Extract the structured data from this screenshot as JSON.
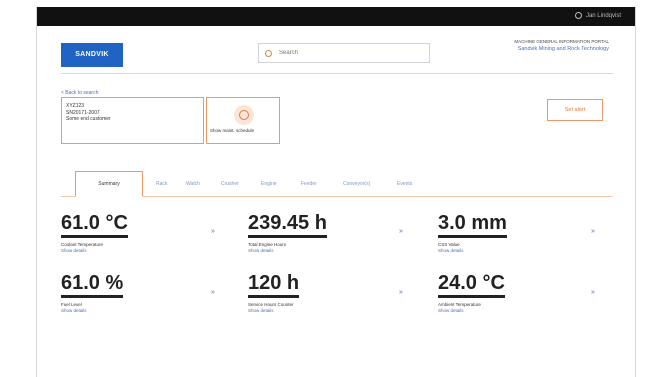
{
  "topbar": {
    "user_label": "Jan Lindqvist"
  },
  "header": {
    "logo_text": "SANDVIK",
    "search_placeholder": "Search",
    "right_line1": "MACHINE GENERAL INFORMATION PORTAL",
    "right_line2": "Sandvik Mining and Rock Technology"
  },
  "machine": {
    "back_link": "< Back to search",
    "id": "XYZ123",
    "serial": "SN20171-2007",
    "customer": "Some end customer",
    "schedule_label": "Show maint. schedule",
    "alert_button": "Set alert"
  },
  "tabs": [
    {
      "label": "Summary",
      "active": true
    },
    {
      "label": "Rack"
    },
    {
      "label": "Watch"
    },
    {
      "label": "Crusher"
    },
    {
      "label": "Engine"
    },
    {
      "label": "Feeder"
    },
    {
      "label": "Conveyor(s)"
    },
    {
      "label": "Events"
    }
  ],
  "metrics": [
    {
      "value": "61.0 °C",
      "label": "Coolant Temperature",
      "link": "Show details"
    },
    {
      "value": "239.45 h",
      "label": "Total Engine Hours",
      "link": "Show details"
    },
    {
      "value": "3.0 mm",
      "label": "CSS Value",
      "link": "Show details"
    },
    {
      "value": "61.0 %",
      "label": "Fuel Level",
      "link": "Show details"
    },
    {
      "value": "120 h",
      "label": "Service Hours Counter",
      "link": "Show details"
    },
    {
      "value": "24.0 °C",
      "label": "Ambient Temperature",
      "link": "Show details"
    }
  ],
  "arrow_glyph": "»"
}
